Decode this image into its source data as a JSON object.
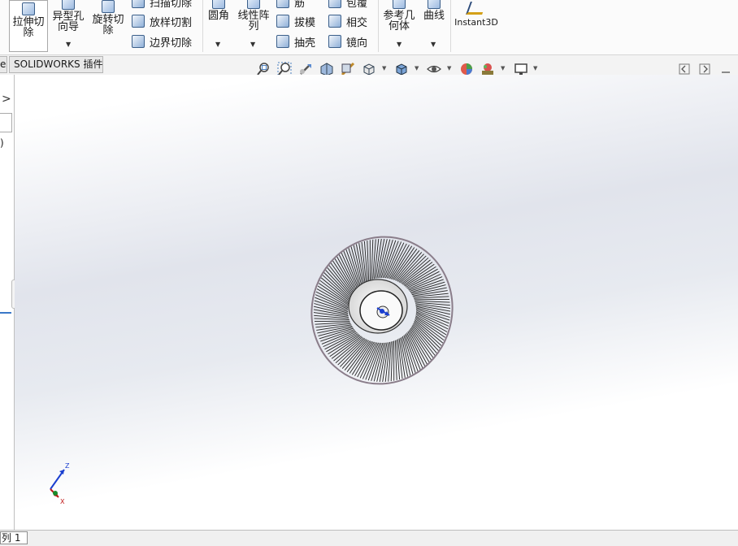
{
  "ribbon": {
    "extrude_cut": "拉伸切\n除",
    "hole_wizard": "异型孔\n向导",
    "revolve_cut": "旋转切\n除",
    "swept_cut": "扫描切除",
    "lofted_cut": "放样切割",
    "boundary_cut": "边界切除",
    "fillet": "圆角",
    "linear_pattern": "线性阵\n列",
    "rib": "筋",
    "draft": "拔模",
    "shell": "抽壳",
    "wrap": "包覆",
    "intersect": "相交",
    "mirror": "镜向",
    "ref_geometry": "参考几\n何体",
    "curves": "曲线",
    "instant3d": "Instant3D"
  },
  "tabs": {
    "partial_left": "e",
    "addins": "SOLIDWORKS 插件"
  },
  "left_panel": {
    "paren": ")"
  },
  "bottom": {
    "tab_label": "列 1"
  },
  "triad": {
    "x": "X",
    "y": "Y",
    "z": "Z"
  },
  "icons": [
    "zoom-to-fit-icon",
    "zoom-to-area-icon",
    "previous-view-icon",
    "section-view-icon",
    "dynamic-annotation-icon",
    "view-orientation-icon",
    "display-style-icon",
    "hide-show-items-icon",
    "edit-appearance-icon",
    "apply-scene-icon",
    "view-settings-icon"
  ]
}
